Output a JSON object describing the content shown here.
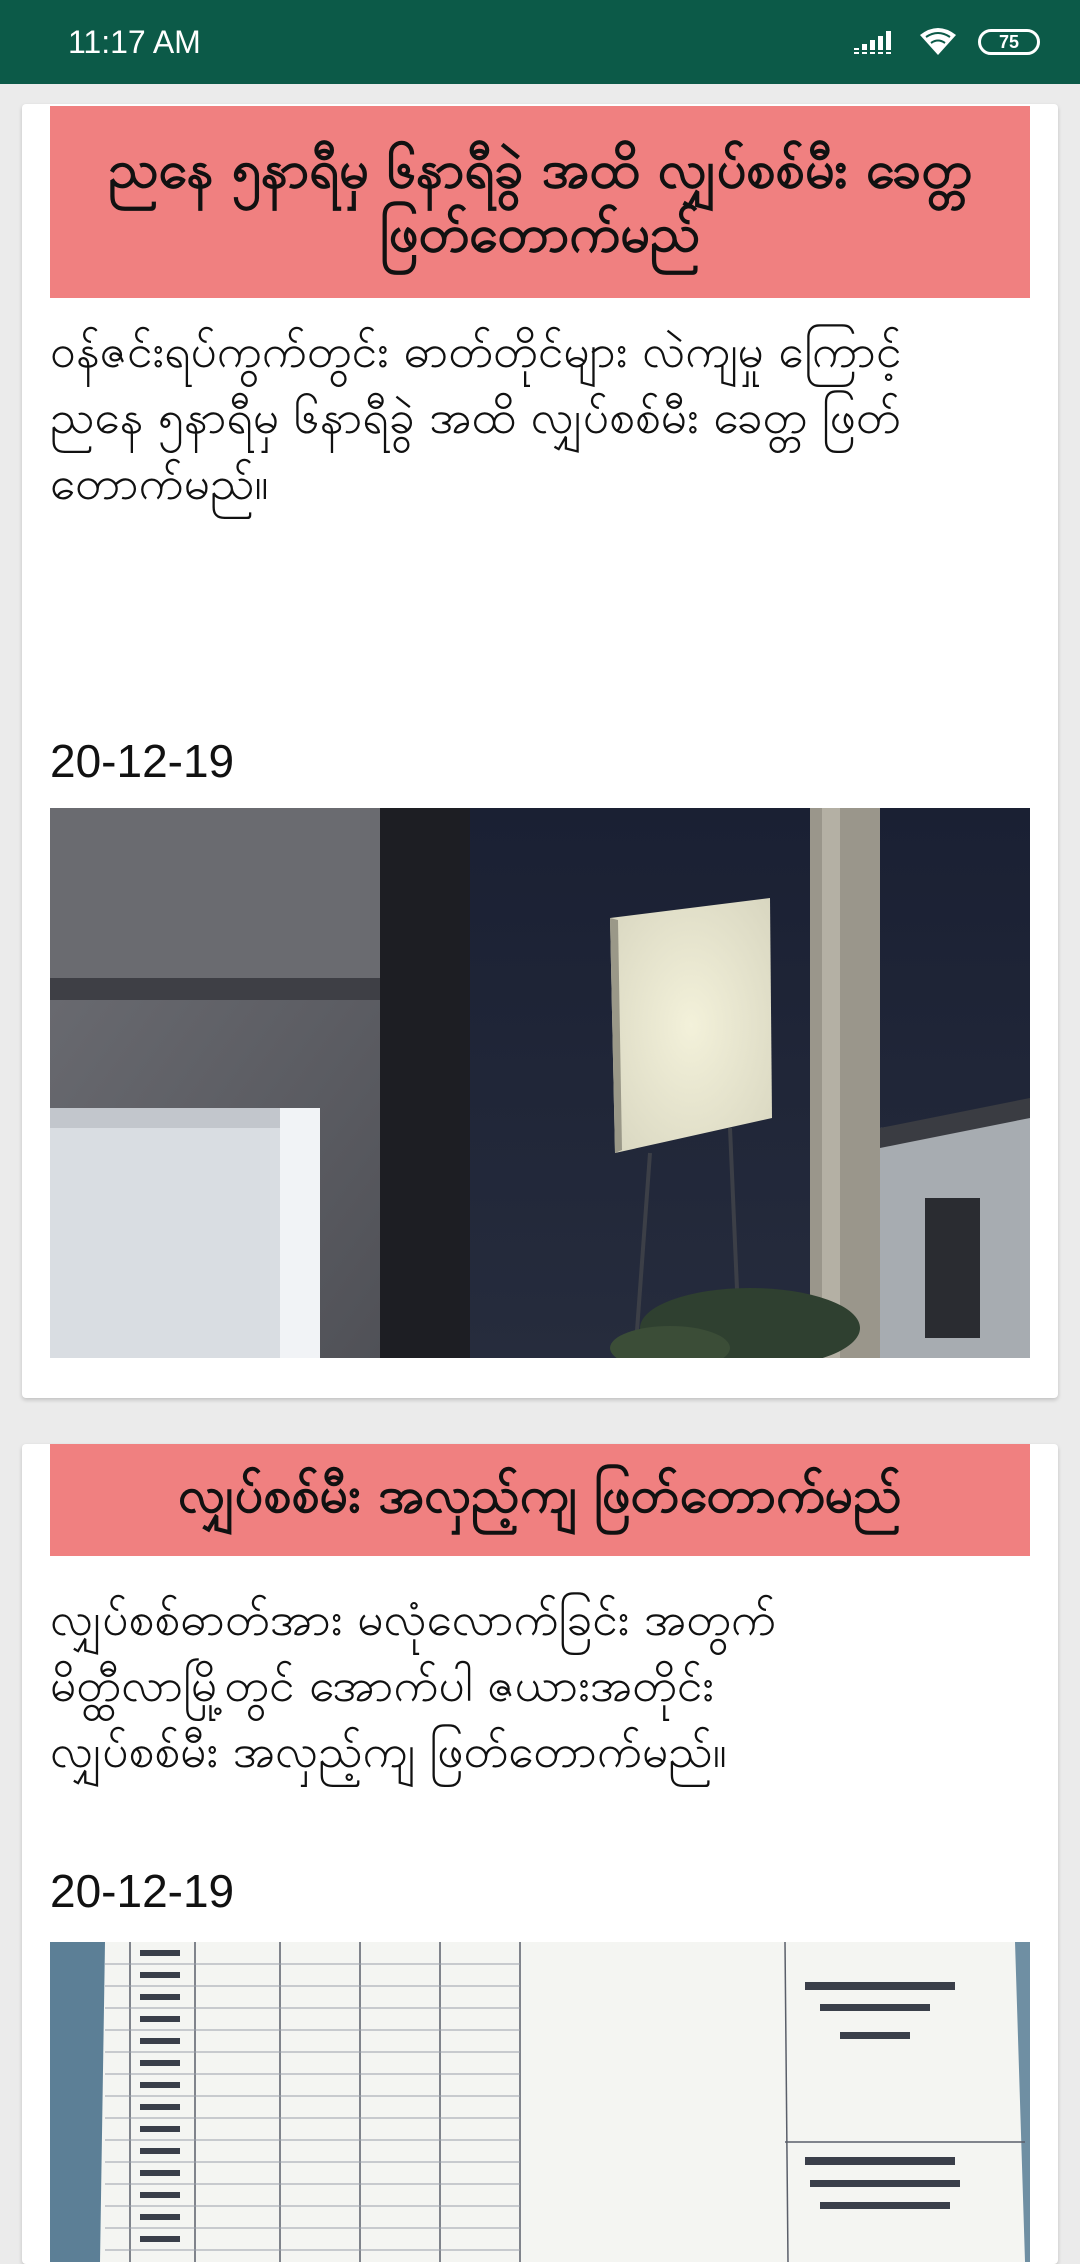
{
  "status_bar": {
    "time": "11:17 AM",
    "battery": "75",
    "icons": [
      "signal-icon",
      "wifi-icon",
      "battery-icon"
    ]
  },
  "feed": [
    {
      "headline": "ညနေ ၅နာရီမှ ၆နာရီခွဲ အထိ လျှပ်စစ်မီး ခေတ္တ ဖြတ်တောက်မည်",
      "body": "ဝန်ဇင်းရပ်ကွက်တွင်း ဓာတ်တိုင်များ လဲကျမှု ကြောင့်\nညနေ ၅နာရီမှ ၆နာရီခွဲ အထိ လျှပ်စစ်မီး ခေတ္တ ဖြတ်တောက်မည်။",
      "date": "20-12-19",
      "image": "night-street-electric-pole-photo"
    },
    {
      "headline": "လျှပ်စစ်မီး အလှည့်ကျ ဖြတ်တောက်မည်",
      "body": "လျှပ်စစ်ဓာတ်အား မလုံလောက်ခြင်း အတွက်\nမိတ္ထီလာမြို့တွင် အောက်ပါ ဇယားအတိုင်း\nလျှပ်စစ်မီး အလှည့်ကျ ဖြတ်တောက်မည်။",
      "date": "20-12-19",
      "image": "power-cut-schedule-table-photo"
    }
  ],
  "colors": {
    "status_bar": "#0c5a48",
    "headline_bg": "#f08080",
    "background": "#ebebeb",
    "card": "#ffffff"
  }
}
